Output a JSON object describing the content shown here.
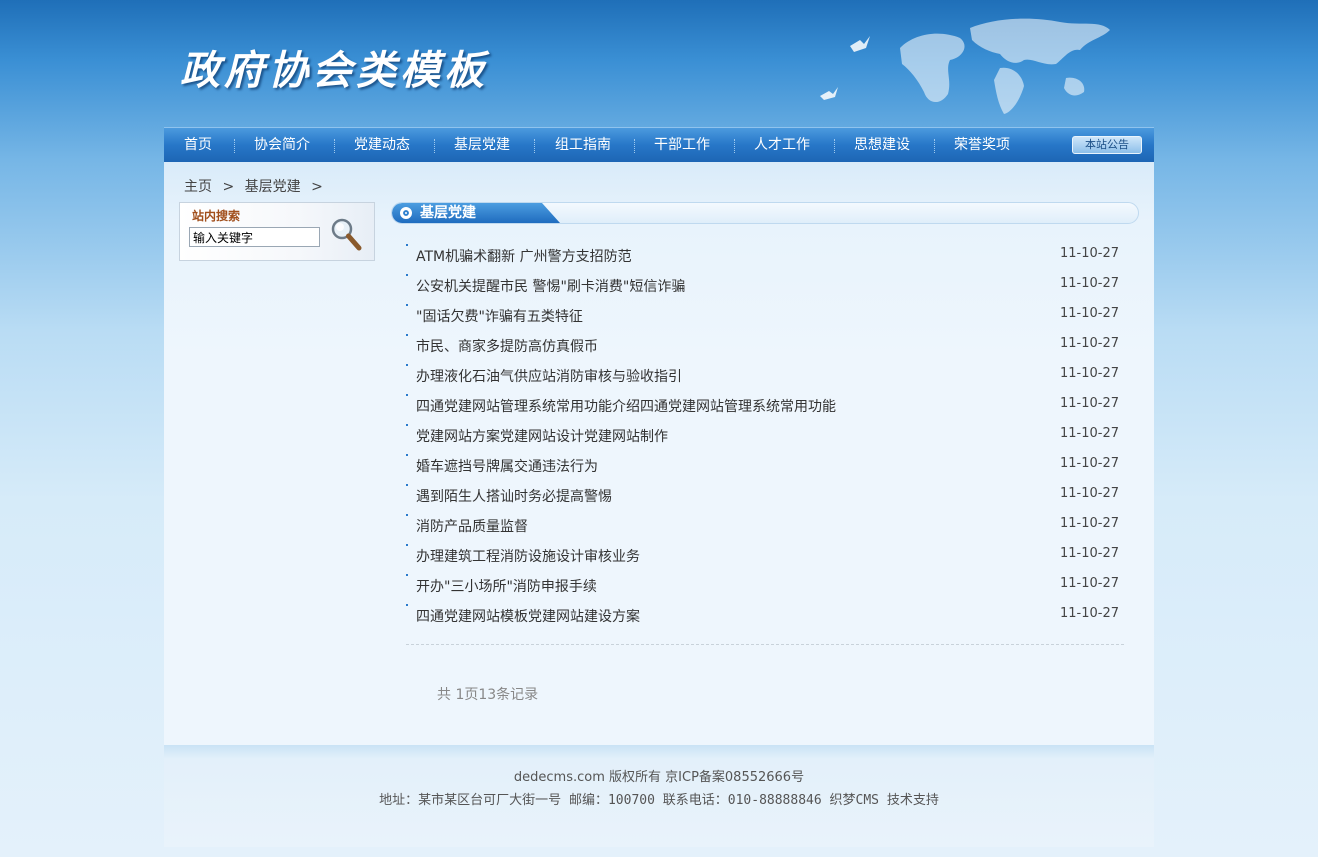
{
  "header": {
    "site_title": "政府协会类模板"
  },
  "nav": {
    "items": [
      {
        "label": "首页"
      },
      {
        "label": "协会简介"
      },
      {
        "label": "党建动态"
      },
      {
        "label": "基层党建"
      },
      {
        "label": "组工指南"
      },
      {
        "label": "干部工作"
      },
      {
        "label": "人才工作"
      },
      {
        "label": "思想建设"
      },
      {
        "label": "荣誉奖项"
      }
    ],
    "notice_button": "本站公告"
  },
  "breadcrumb": {
    "home": "主页",
    "sep": ">",
    "current": "基层党建"
  },
  "search": {
    "title": "站内搜索",
    "input_value": "输入关键字"
  },
  "section": {
    "title": "基层党建"
  },
  "articles": [
    {
      "title": "ATM机骗术翻新 广州警方支招防范",
      "date": "11-10-27"
    },
    {
      "title": "公安机关提醒市民 警惕\"刷卡消费\"短信诈骗",
      "date": "11-10-27"
    },
    {
      "title": "\"固话欠费\"诈骗有五类特征",
      "date": "11-10-27"
    },
    {
      "title": "市民、商家多提防高仿真假币",
      "date": "11-10-27"
    },
    {
      "title": "办理液化石油气供应站消防审核与验收指引",
      "date": "11-10-27"
    },
    {
      "title": "四通党建网站管理系统常用功能介绍四通党建网站管理系统常用功能",
      "date": "11-10-27"
    },
    {
      "title": "党建网站方案党建网站设计党建网站制作",
      "date": "11-10-27"
    },
    {
      "title": "婚车遮挡号牌属交通违法行为",
      "date": "11-10-27"
    },
    {
      "title": "遇到陌生人搭讪时务必提高警惕",
      "date": "11-10-27"
    },
    {
      "title": "消防产品质量监督",
      "date": "11-10-27"
    },
    {
      "title": "办理建筑工程消防设施设计审核业务",
      "date": "11-10-27"
    },
    {
      "title": "开办\"三小场所\"消防申报手续",
      "date": "11-10-27"
    },
    {
      "title": "四通党建网站模板党建网站建设方案",
      "date": "11-10-27"
    }
  ],
  "pagination": {
    "text": "共 1页13条记录"
  },
  "footer": {
    "line1": "dedecms.com 版权所有 京ICP备案08552666号",
    "line2": "地址：某市某区台可厂大街一号  邮编：100700  联系电话：010-88888846 织梦CMS 技术支持"
  },
  "colors": {
    "nav_bg": "#2777c8",
    "accent": "#2a7acc",
    "search_title": "#a14f1c"
  }
}
